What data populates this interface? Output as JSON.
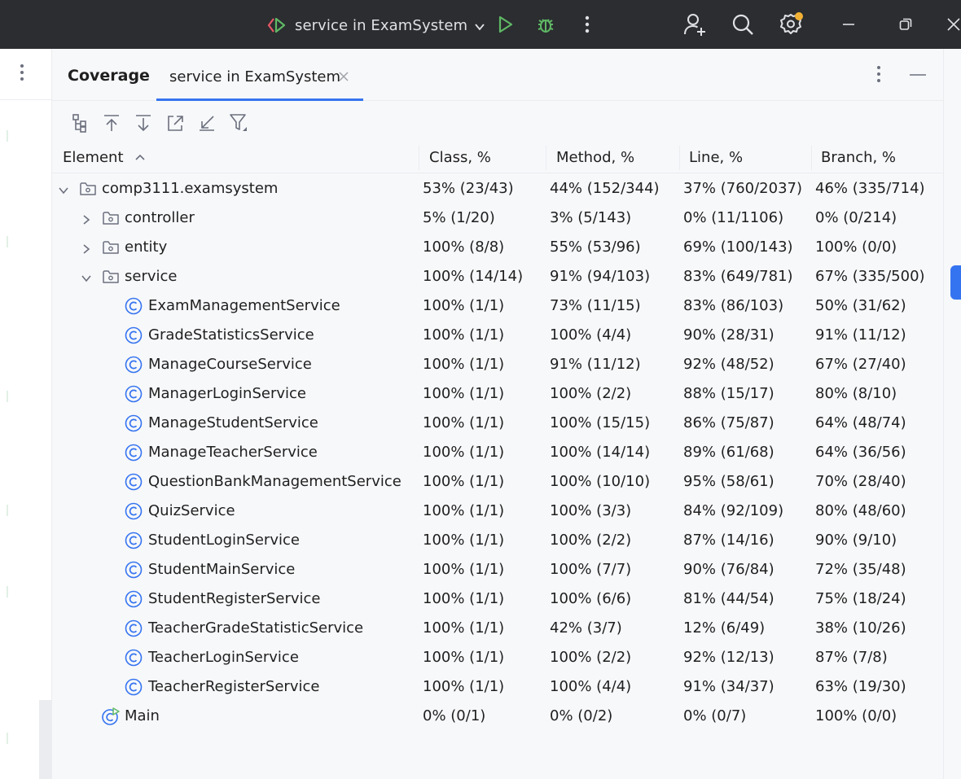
{
  "titlebar": {
    "run_config_label": "service in ExamSystem"
  },
  "panel": {
    "tool_window_title": "Coverage",
    "tab_label": "service in ExamSystem"
  },
  "toolbar": {
    "icons": [
      "collapse-all-icon",
      "navigate-up-icon",
      "navigate-down-icon",
      "expand-icon",
      "collapse-icon",
      "filter-icon"
    ]
  },
  "table": {
    "columns": [
      {
        "label": "Element",
        "sorted": "ascending"
      },
      {
        "label": "Class, %"
      },
      {
        "label": "Method, %"
      },
      {
        "label": "Line, %"
      },
      {
        "label": "Branch, %"
      }
    ],
    "rows": [
      {
        "level": 0,
        "kind": "package",
        "state": "expanded",
        "name": "comp3111.examsystem",
        "cls": "53% (23/43)",
        "method": "44% (152/344)",
        "line": "37% (760/2037)",
        "branch": "46% (335/714)"
      },
      {
        "level": 1,
        "kind": "package",
        "state": "collapsed",
        "name": "controller",
        "cls": "5% (1/20)",
        "method": "3% (5/143)",
        "line": "0% (11/1106)",
        "branch": "0% (0/214)"
      },
      {
        "level": 1,
        "kind": "package",
        "state": "collapsed",
        "name": "entity",
        "cls": "100% (8/8)",
        "method": "55% (53/96)",
        "line": "69% (100/143)",
        "branch": "100% (0/0)"
      },
      {
        "level": 1,
        "kind": "package",
        "state": "expanded",
        "name": "service",
        "cls": "100% (14/14)",
        "method": "91% (94/103)",
        "line": "83% (649/781)",
        "branch": "67% (335/500)"
      },
      {
        "level": 2,
        "kind": "class",
        "name": "ExamManagementService",
        "cls": "100% (1/1)",
        "method": "73% (11/15)",
        "line": "83% (86/103)",
        "branch": "50% (31/62)"
      },
      {
        "level": 2,
        "kind": "class",
        "name": "GradeStatisticsService",
        "cls": "100% (1/1)",
        "method": "100% (4/4)",
        "line": "90% (28/31)",
        "branch": "91% (11/12)"
      },
      {
        "level": 2,
        "kind": "class",
        "name": "ManageCourseService",
        "cls": "100% (1/1)",
        "method": "91% (11/12)",
        "line": "92% (48/52)",
        "branch": "67% (27/40)"
      },
      {
        "level": 2,
        "kind": "class",
        "name": "ManagerLoginService",
        "cls": "100% (1/1)",
        "method": "100% (2/2)",
        "line": "88% (15/17)",
        "branch": "80% (8/10)"
      },
      {
        "level": 2,
        "kind": "class",
        "name": "ManageStudentService",
        "cls": "100% (1/1)",
        "method": "100% (15/15)",
        "line": "86% (75/87)",
        "branch": "64% (48/74)"
      },
      {
        "level": 2,
        "kind": "class",
        "name": "ManageTeacherService",
        "cls": "100% (1/1)",
        "method": "100% (14/14)",
        "line": "89% (61/68)",
        "branch": "64% (36/56)"
      },
      {
        "level": 2,
        "kind": "class",
        "name": "QuestionBankManagementService",
        "cls": "100% (1/1)",
        "method": "100% (10/10)",
        "line": "95% (58/61)",
        "branch": "70% (28/40)"
      },
      {
        "level": 2,
        "kind": "class",
        "name": "QuizService",
        "cls": "100% (1/1)",
        "method": "100% (3/3)",
        "line": "84% (92/109)",
        "branch": "80% (48/60)"
      },
      {
        "level": 2,
        "kind": "class",
        "name": "StudentLoginService",
        "cls": "100% (1/1)",
        "method": "100% (2/2)",
        "line": "87% (14/16)",
        "branch": "90% (9/10)"
      },
      {
        "level": 2,
        "kind": "class",
        "name": "StudentMainService",
        "cls": "100% (1/1)",
        "method": "100% (7/7)",
        "line": "90% (76/84)",
        "branch": "72% (35/48)"
      },
      {
        "level": 2,
        "kind": "class",
        "name": "StudentRegisterService",
        "cls": "100% (1/1)",
        "method": "100% (6/6)",
        "line": "81% (44/54)",
        "branch": "75% (18/24)"
      },
      {
        "level": 2,
        "kind": "class",
        "name": "TeacherGradeStatisticService",
        "cls": "100% (1/1)",
        "method": "42% (3/7)",
        "line": "12% (6/49)",
        "branch": "38% (10/26)"
      },
      {
        "level": 2,
        "kind": "class",
        "name": "TeacherLoginService",
        "cls": "100% (1/1)",
        "method": "100% (2/2)",
        "line": "92% (12/13)",
        "branch": "87% (7/8)"
      },
      {
        "level": 2,
        "kind": "class",
        "name": "TeacherRegisterService",
        "cls": "100% (1/1)",
        "method": "100% (4/4)",
        "line": "91% (34/37)",
        "branch": "63% (19/30)"
      },
      {
        "level": 1,
        "kind": "main-class",
        "name": "Main",
        "cls": "0% (0/1)",
        "method": "0% (0/2)",
        "line": "0% (0/7)",
        "branch": "100% (0/0)"
      }
    ]
  },
  "colors": {
    "titlebar_bg": "#2b2d30",
    "accent": "#3574f0",
    "run_green": "#5fb865",
    "notification_dot": "#f2b134",
    "class_icon": "#3574f0"
  }
}
